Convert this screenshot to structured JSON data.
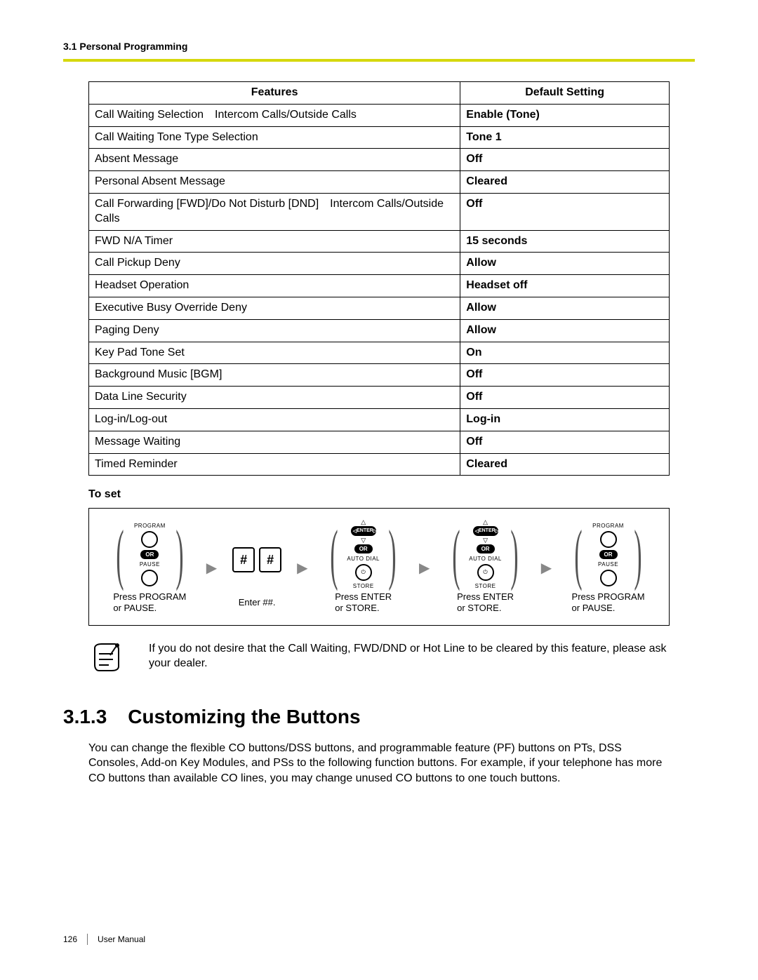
{
  "header": {
    "section": "3.1 Personal Programming"
  },
  "table": {
    "col_features": "Features",
    "col_default": "Default Setting",
    "rows": [
      {
        "feature": "Call Waiting Selection Intercom Calls/Outside Calls",
        "default": "Enable (Tone)"
      },
      {
        "feature": "Call Waiting Tone Type Selection",
        "default": "Tone 1"
      },
      {
        "feature": "Absent Message",
        "default": "Off"
      },
      {
        "feature": "Personal Absent Message",
        "default": "Cleared"
      },
      {
        "feature": "Call Forwarding [FWD]/Do Not Disturb [DND] Intercom Calls/Outside Calls",
        "default": "Off"
      },
      {
        "feature": "FWD N/A Timer",
        "default": "15 seconds"
      },
      {
        "feature": "Call Pickup Deny",
        "default": "Allow"
      },
      {
        "feature": "Headset Operation",
        "default": "Headset off"
      },
      {
        "feature": "Executive Busy Override Deny",
        "default": "Allow"
      },
      {
        "feature": "Paging Deny",
        "default": "Allow"
      },
      {
        "feature": "Key Pad Tone Set",
        "default": "On"
      },
      {
        "feature": "Background Music [BGM]",
        "default": "Off"
      },
      {
        "feature": "Data Line Security",
        "default": "Off"
      },
      {
        "feature": "Log-in/Log-out",
        "default": "Log-in"
      },
      {
        "feature": "Message Waiting",
        "default": "Off"
      },
      {
        "feature": "Timed Reminder",
        "default": "Cleared"
      }
    ]
  },
  "to_set": "To set",
  "procedure": {
    "labels": {
      "program": "PROGRAM",
      "or": "OR",
      "pause": "PAUSE",
      "enter": "ENTER",
      "autodial": "AUTO DIAL",
      "store": "STORE",
      "hash": "#"
    },
    "captions": {
      "s1": "Press PROGRAM\nor PAUSE.",
      "s2": "Enter ##.",
      "s3": "Press ENTER\nor STORE.",
      "s4": "Press ENTER\nor STORE.",
      "s5": "Press PROGRAM\nor PAUSE."
    }
  },
  "note": "If you do not desire that the Call Waiting, FWD/DND or Hot Line to be cleared by this feature, please ask your dealer.",
  "section": {
    "number": "3.1.3",
    "title": "Customizing the Buttons",
    "body": "You can change the flexible CO buttons/DSS buttons, and programmable feature (PF) buttons on PTs, DSS Consoles, Add-on Key Modules, and PSs to the following function buttons. For example, if your telephone has more CO buttons than available CO lines, you may change unused CO buttons to one touch buttons."
  },
  "footer": {
    "page": "126",
    "doc": "User Manual"
  }
}
